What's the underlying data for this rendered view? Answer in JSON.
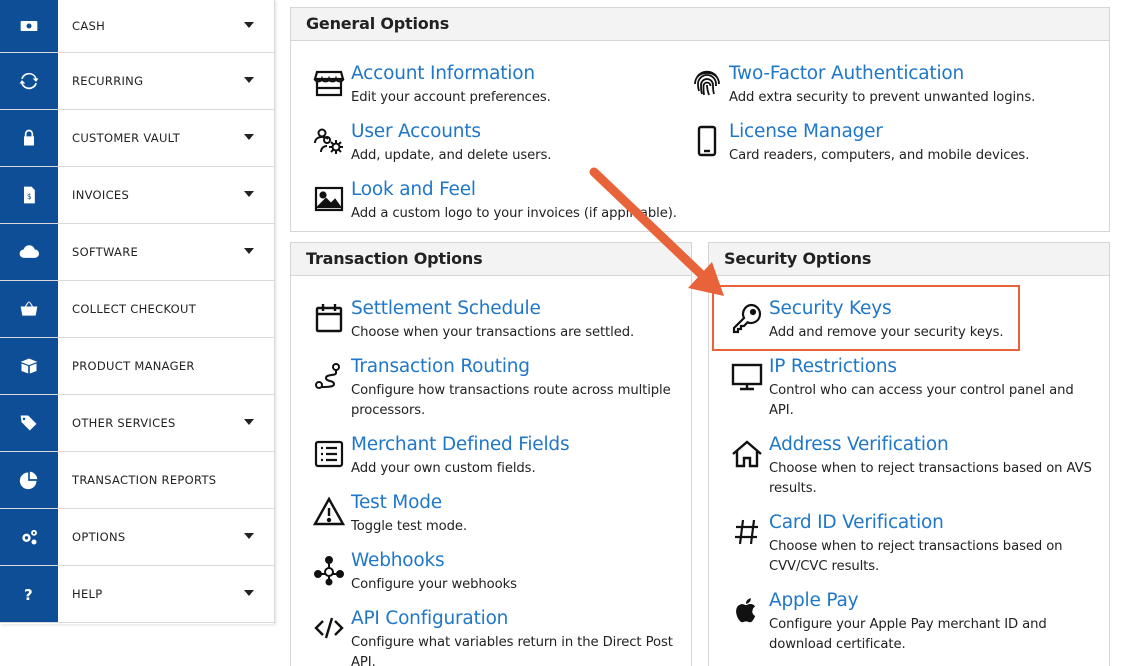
{
  "sidebar": {
    "items": [
      {
        "label": "CASH",
        "icon": "cash-icon",
        "has_caret": true
      },
      {
        "label": "RECURRING",
        "icon": "refresh-icon",
        "has_caret": true
      },
      {
        "label": "CUSTOMER VAULT",
        "icon": "lock-icon",
        "has_caret": true
      },
      {
        "label": "INVOICES",
        "icon": "invoice-icon",
        "has_caret": true
      },
      {
        "label": "SOFTWARE",
        "icon": "cloud-icon",
        "has_caret": true
      },
      {
        "label": "COLLECT CHECKOUT",
        "icon": "basket-icon",
        "has_caret": false
      },
      {
        "label": "PRODUCT MANAGER",
        "icon": "box-icon",
        "has_caret": false
      },
      {
        "label": "OTHER SERVICES",
        "icon": "tags-icon",
        "has_caret": true
      },
      {
        "label": "TRANSACTION REPORTS",
        "icon": "pie-chart-icon",
        "has_caret": false
      },
      {
        "label": "OPTIONS",
        "icon": "gears-icon",
        "has_caret": true
      },
      {
        "label": "HELP",
        "icon": "question-icon",
        "has_caret": true
      }
    ]
  },
  "general": {
    "title": "General Options",
    "items": [
      {
        "title": "Account Information",
        "desc": "Edit your account preferences.",
        "icon": "store-icon"
      },
      {
        "title": "User Accounts",
        "desc": "Add, update, and delete users.",
        "icon": "users-gear-icon"
      },
      {
        "title": "Look and Feel",
        "desc": "Add a custom logo to your invoices (if applicable).",
        "icon": "image-icon"
      },
      {
        "title": "Two-Factor Authentication",
        "desc": "Add extra security to prevent unwanted logins.",
        "icon": "fingerprint-icon"
      },
      {
        "title": "License Manager",
        "desc": "Card readers, computers, and mobile devices.",
        "icon": "mobile-icon"
      }
    ]
  },
  "transaction": {
    "title": "Transaction Options",
    "items": [
      {
        "title": "Settlement Schedule",
        "desc": "Choose when your transactions are settled.",
        "icon": "calendar-icon"
      },
      {
        "title": "Transaction Routing",
        "desc": "Configure how transactions route across multiple processors.",
        "icon": "route-icon"
      },
      {
        "title": "Merchant Defined Fields",
        "desc": "Add your own custom fields.",
        "icon": "list-icon"
      },
      {
        "title": "Test Mode",
        "desc": "Toggle test mode.",
        "icon": "warning-icon"
      },
      {
        "title": "Webhooks",
        "desc": "Configure your webhooks",
        "icon": "webhook-icon"
      },
      {
        "title": "API Configuration",
        "desc": "Configure what variables return in the Direct Post API.",
        "icon": "code-icon"
      }
    ]
  },
  "security": {
    "title": "Security Options",
    "items": [
      {
        "title": "Security Keys",
        "desc": "Add and remove your security keys.",
        "icon": "key-icon"
      },
      {
        "title": "IP Restrictions",
        "desc": "Control who can access your control panel and API.",
        "icon": "monitor-icon"
      },
      {
        "title": "Address Verification",
        "desc": "Choose when to reject transactions based on AVS results.",
        "icon": "home-icon"
      },
      {
        "title": "Card ID Verification",
        "desc": "Choose when to reject transactions based on CVV/CVC results.",
        "icon": "hash-icon"
      },
      {
        "title": "Apple Pay",
        "desc": "Configure your Apple Pay merchant ID and download certificate.",
        "icon": "apple-icon"
      }
    ]
  },
  "colors": {
    "sidebar_icon_bg": "#0d4e96",
    "link": "#1f77c9",
    "annotation": "#e8633a"
  }
}
